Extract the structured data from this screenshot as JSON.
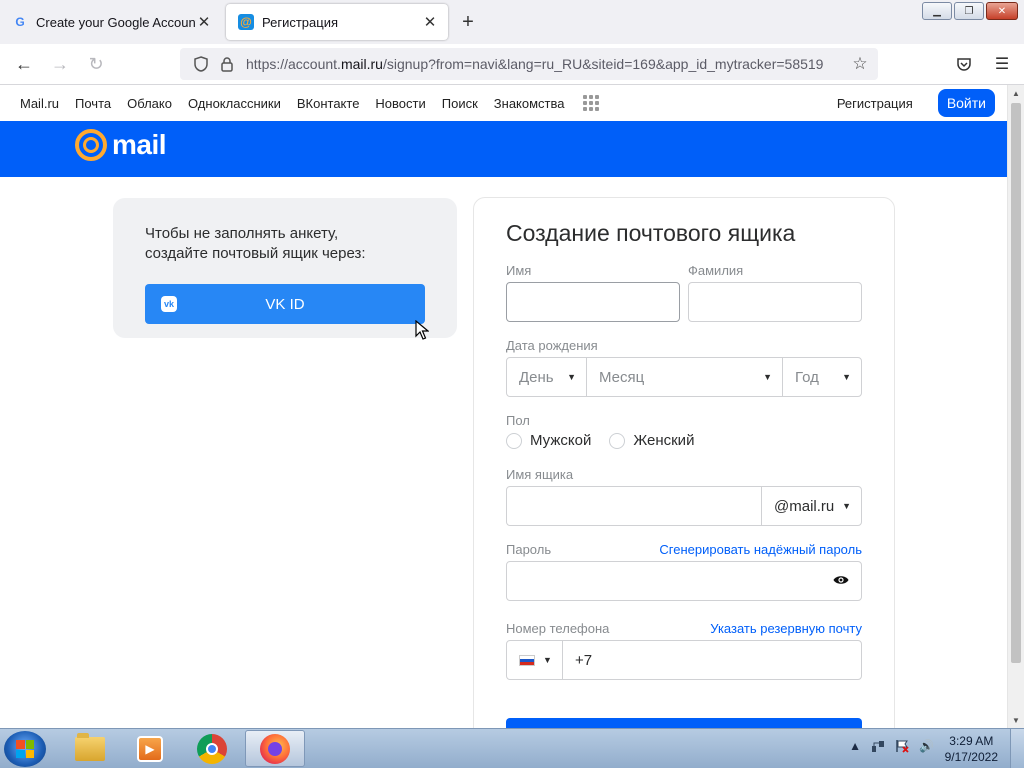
{
  "browser": {
    "tabs": [
      {
        "title": "Create your Google Account",
        "favicon": "google-g-icon"
      },
      {
        "title": "Регистрация",
        "favicon": "mailru-at-icon",
        "active": true
      }
    ],
    "new_tab_label": "+",
    "url_prefix": "https://account.",
    "url_host": "mail.ru",
    "url_rest": "/signup?from=navi&lang=ru_RU&siteid=169&app_id_mytracker=58519"
  },
  "mailnav": {
    "links": [
      "Mail.ru",
      "Почта",
      "Облако",
      "Одноклассники",
      "ВКонтакте",
      "Новости",
      "Поиск",
      "Знакомства"
    ],
    "register": "Регистрация",
    "login": "Войти"
  },
  "banner": {
    "logo_word": "mail",
    "color": "#005ff9",
    "accent": "#ffa930"
  },
  "vk_card": {
    "text": "Чтобы не заполнять анкету, создайте почтовый ящик через:",
    "button": "VK ID",
    "icon_text": "vk"
  },
  "form": {
    "title": "Создание почтового ящика",
    "first_name_label": "Имя",
    "last_name_label": "Фамилия",
    "dob_label": "Дата рождения",
    "day": "День",
    "month": "Месяц",
    "year": "Год",
    "gender_label": "Пол",
    "male": "Мужской",
    "female": "Женский",
    "mailbox_label": "Имя ящика",
    "domain": "@mail.ru",
    "password_label": "Пароль",
    "generate_password": "Сгенерировать надёжный пароль",
    "phone_label": "Номер телефона",
    "backup_email": "Указать резервную почту",
    "phone_code": "+7"
  },
  "taskbar": {
    "time": "3:29 AM",
    "date": "9/17/2022"
  }
}
